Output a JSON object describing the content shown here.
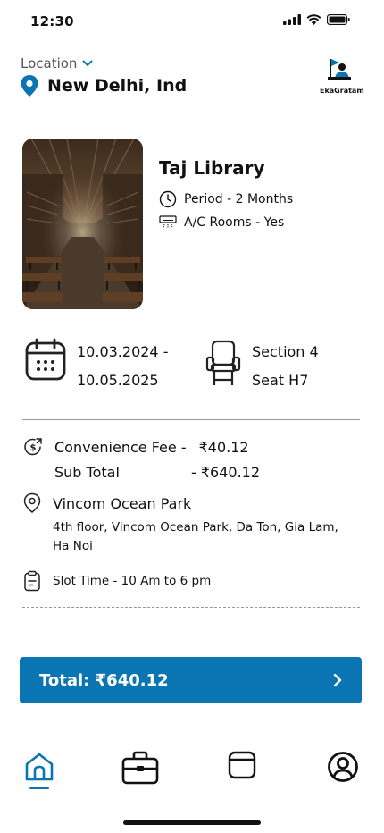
{
  "status": {
    "time": "12:30"
  },
  "location": {
    "label": "Location",
    "city": "New Delhi, Ind"
  },
  "logo": {
    "text": "EkaGratam"
  },
  "library": {
    "name": "Taj Library",
    "period": "Period - 2 Months",
    "ac": "A/C Rooms - Yes"
  },
  "booking": {
    "date_start": "10.03.2024 -",
    "date_end": "10.05.2025",
    "section": "Section 4",
    "seat": "Seat H7"
  },
  "fees": {
    "convenience_label": "Convenience Fee -",
    "convenience_value": "₹40.12",
    "subtotal_label": "Sub Total",
    "subtotal_value": "- ₹640.12"
  },
  "address": {
    "title": "Vincom Ocean Park",
    "text": "4th floor, Vincom Ocean Park, Da Ton, Gia Lam, Ha Noi"
  },
  "slot": {
    "text": "Slot Time - 10 Am to 6 pm"
  },
  "total": {
    "label": "Total: ₹640.12"
  },
  "colors": {
    "accent": "#0b74b3",
    "text": "#111111"
  },
  "nav": {
    "items": [
      "home-icon",
      "briefcase-icon",
      "calendar-icon",
      "profile-icon"
    ],
    "active": "home"
  }
}
